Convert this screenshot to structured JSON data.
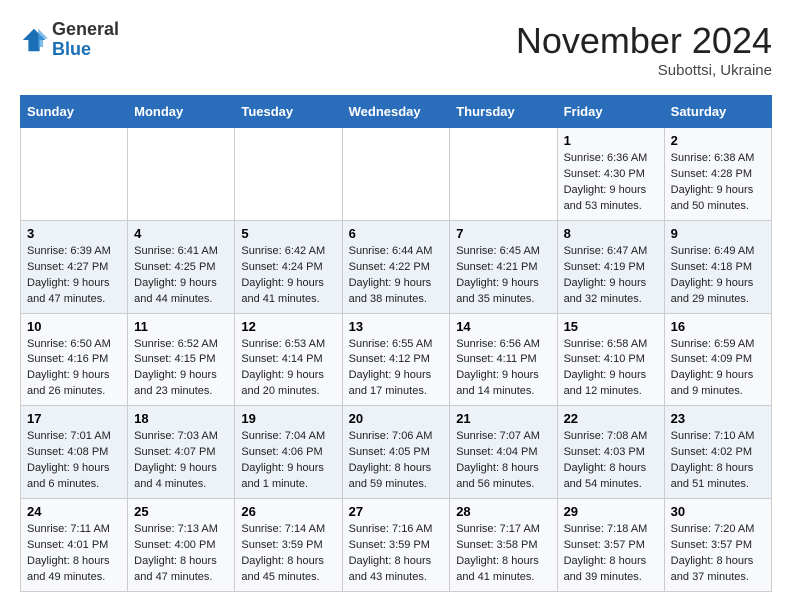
{
  "logo": {
    "general": "General",
    "blue": "Blue"
  },
  "header": {
    "month": "November 2024",
    "location": "Subottsi, Ukraine"
  },
  "weekdays": [
    "Sunday",
    "Monday",
    "Tuesday",
    "Wednesday",
    "Thursday",
    "Friday",
    "Saturday"
  ],
  "weeks": [
    [
      {
        "day": "",
        "info": ""
      },
      {
        "day": "",
        "info": ""
      },
      {
        "day": "",
        "info": ""
      },
      {
        "day": "",
        "info": ""
      },
      {
        "day": "",
        "info": ""
      },
      {
        "day": "1",
        "info": "Sunrise: 6:36 AM\nSunset: 4:30 PM\nDaylight: 9 hours\nand 53 minutes."
      },
      {
        "day": "2",
        "info": "Sunrise: 6:38 AM\nSunset: 4:28 PM\nDaylight: 9 hours\nand 50 minutes."
      }
    ],
    [
      {
        "day": "3",
        "info": "Sunrise: 6:39 AM\nSunset: 4:27 PM\nDaylight: 9 hours\nand 47 minutes."
      },
      {
        "day": "4",
        "info": "Sunrise: 6:41 AM\nSunset: 4:25 PM\nDaylight: 9 hours\nand 44 minutes."
      },
      {
        "day": "5",
        "info": "Sunrise: 6:42 AM\nSunset: 4:24 PM\nDaylight: 9 hours\nand 41 minutes."
      },
      {
        "day": "6",
        "info": "Sunrise: 6:44 AM\nSunset: 4:22 PM\nDaylight: 9 hours\nand 38 minutes."
      },
      {
        "day": "7",
        "info": "Sunrise: 6:45 AM\nSunset: 4:21 PM\nDaylight: 9 hours\nand 35 minutes."
      },
      {
        "day": "8",
        "info": "Sunrise: 6:47 AM\nSunset: 4:19 PM\nDaylight: 9 hours\nand 32 minutes."
      },
      {
        "day": "9",
        "info": "Sunrise: 6:49 AM\nSunset: 4:18 PM\nDaylight: 9 hours\nand 29 minutes."
      }
    ],
    [
      {
        "day": "10",
        "info": "Sunrise: 6:50 AM\nSunset: 4:16 PM\nDaylight: 9 hours\nand 26 minutes."
      },
      {
        "day": "11",
        "info": "Sunrise: 6:52 AM\nSunset: 4:15 PM\nDaylight: 9 hours\nand 23 minutes."
      },
      {
        "day": "12",
        "info": "Sunrise: 6:53 AM\nSunset: 4:14 PM\nDaylight: 9 hours\nand 20 minutes."
      },
      {
        "day": "13",
        "info": "Sunrise: 6:55 AM\nSunset: 4:12 PM\nDaylight: 9 hours\nand 17 minutes."
      },
      {
        "day": "14",
        "info": "Sunrise: 6:56 AM\nSunset: 4:11 PM\nDaylight: 9 hours\nand 14 minutes."
      },
      {
        "day": "15",
        "info": "Sunrise: 6:58 AM\nSunset: 4:10 PM\nDaylight: 9 hours\nand 12 minutes."
      },
      {
        "day": "16",
        "info": "Sunrise: 6:59 AM\nSunset: 4:09 PM\nDaylight: 9 hours\nand 9 minutes."
      }
    ],
    [
      {
        "day": "17",
        "info": "Sunrise: 7:01 AM\nSunset: 4:08 PM\nDaylight: 9 hours\nand 6 minutes."
      },
      {
        "day": "18",
        "info": "Sunrise: 7:03 AM\nSunset: 4:07 PM\nDaylight: 9 hours\nand 4 minutes."
      },
      {
        "day": "19",
        "info": "Sunrise: 7:04 AM\nSunset: 4:06 PM\nDaylight: 9 hours\nand 1 minute."
      },
      {
        "day": "20",
        "info": "Sunrise: 7:06 AM\nSunset: 4:05 PM\nDaylight: 8 hours\nand 59 minutes."
      },
      {
        "day": "21",
        "info": "Sunrise: 7:07 AM\nSunset: 4:04 PM\nDaylight: 8 hours\nand 56 minutes."
      },
      {
        "day": "22",
        "info": "Sunrise: 7:08 AM\nSunset: 4:03 PM\nDaylight: 8 hours\nand 54 minutes."
      },
      {
        "day": "23",
        "info": "Sunrise: 7:10 AM\nSunset: 4:02 PM\nDaylight: 8 hours\nand 51 minutes."
      }
    ],
    [
      {
        "day": "24",
        "info": "Sunrise: 7:11 AM\nSunset: 4:01 PM\nDaylight: 8 hours\nand 49 minutes."
      },
      {
        "day": "25",
        "info": "Sunrise: 7:13 AM\nSunset: 4:00 PM\nDaylight: 8 hours\nand 47 minutes."
      },
      {
        "day": "26",
        "info": "Sunrise: 7:14 AM\nSunset: 3:59 PM\nDaylight: 8 hours\nand 45 minutes."
      },
      {
        "day": "27",
        "info": "Sunrise: 7:16 AM\nSunset: 3:59 PM\nDaylight: 8 hours\nand 43 minutes."
      },
      {
        "day": "28",
        "info": "Sunrise: 7:17 AM\nSunset: 3:58 PM\nDaylight: 8 hours\nand 41 minutes."
      },
      {
        "day": "29",
        "info": "Sunrise: 7:18 AM\nSunset: 3:57 PM\nDaylight: 8 hours\nand 39 minutes."
      },
      {
        "day": "30",
        "info": "Sunrise: 7:20 AM\nSunset: 3:57 PM\nDaylight: 8 hours\nand 37 minutes."
      }
    ]
  ]
}
